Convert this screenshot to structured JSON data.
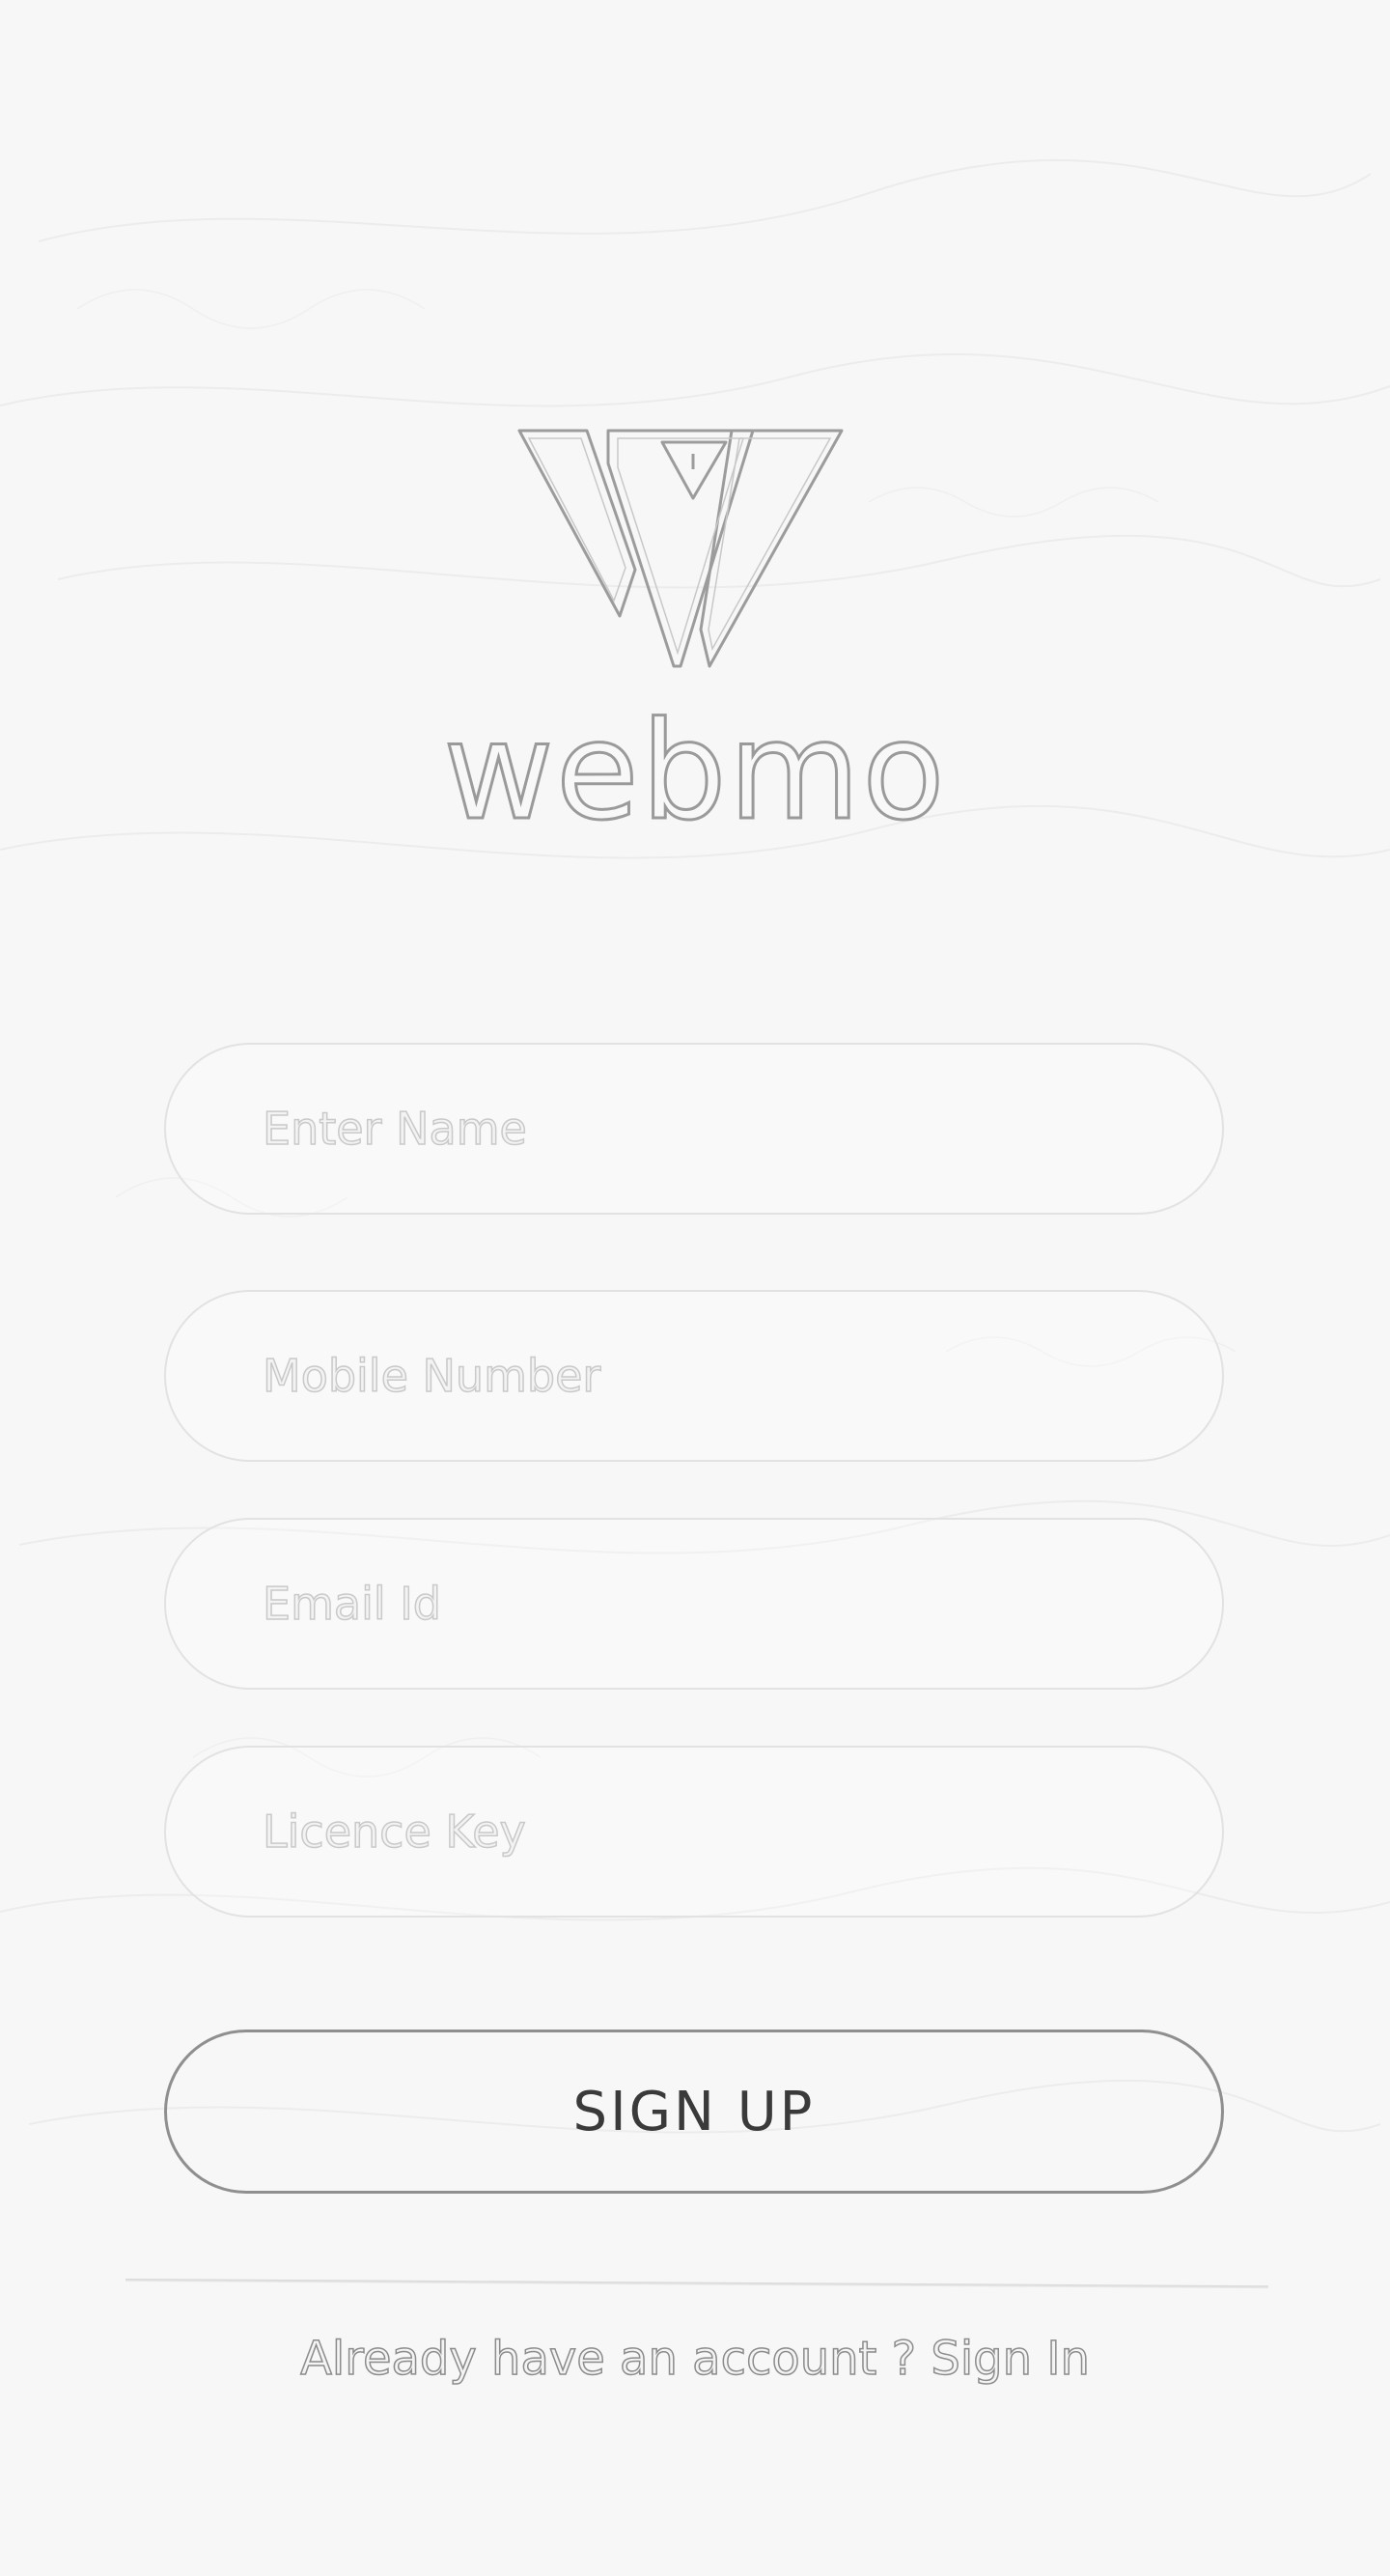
{
  "brand": {
    "name": "webmo",
    "logo_icon": "webmo-w-logo-icon"
  },
  "form": {
    "name_placeholder": "Enter Name",
    "mobile_placeholder": "Mobile Number",
    "email_placeholder": "Email Id",
    "licence_placeholder": "Licence Key",
    "name_value": "",
    "mobile_value": "",
    "email_value": "",
    "licence_value": ""
  },
  "actions": {
    "signup_label": "SIGN UP",
    "signin_prompt": "Already have an account ?",
    "signin_link": "Sign In"
  },
  "colors": {
    "background": "#f7f7f7",
    "outline": "#9a9a9a",
    "field_border": "#e2e2e2",
    "button_border": "#8f8f8f",
    "button_text": "#3a3a3a"
  }
}
